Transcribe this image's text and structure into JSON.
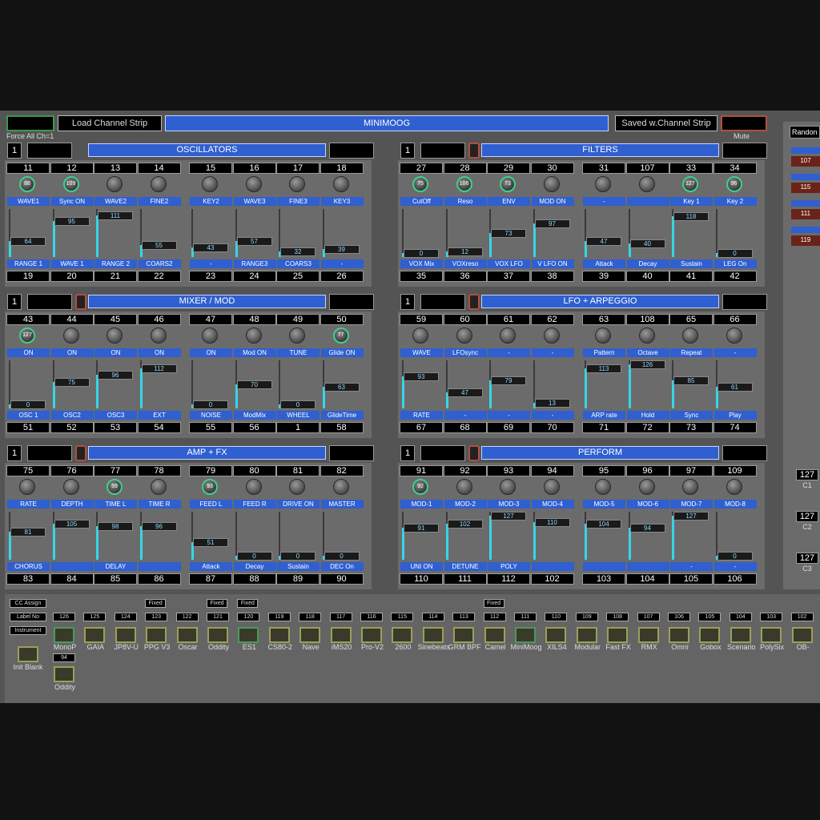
{
  "header": {
    "load_label": "Load Channel Strip",
    "title": "MINIMOOG",
    "save_label": "Saved w.Channel Strip",
    "force_label": "Force All Ch=1",
    "mute_label": "Mute",
    "random_label": "Randon"
  },
  "sections": [
    {
      "id": "oscillators",
      "title": "OSCILLATORS",
      "channel": "1",
      "cc_top": [
        "11",
        "12",
        "13",
        "14",
        "15",
        "16",
        "17",
        "18"
      ],
      "knobs": [
        "88",
        "109",
        "",
        "",
        "",
        "",
        "",
        ""
      ],
      "knob_labels": [
        "WAVE1",
        "Sync ON",
        "WAVE2",
        "FINE2",
        "KEY2",
        "WAVE3",
        "FINE3",
        "KEY3"
      ],
      "faders": [
        "64",
        "95",
        "111",
        "55",
        "43",
        "57",
        "32",
        "39"
      ],
      "fader_levels": [
        0.3,
        0.8,
        0.95,
        0.2,
        0.15,
        0.3,
        0.05,
        0.1
      ],
      "fader_labels": [
        "RANGE 1",
        "WAVE 1",
        "RANGE 2",
        "COARS2",
        "-",
        "RANGE3",
        "COARS3",
        "-"
      ],
      "cc_bottom": [
        "19",
        "20",
        "21",
        "22",
        "23",
        "24",
        "25",
        "26"
      ]
    },
    {
      "id": "filters",
      "title": "FILTERS",
      "channel": "1",
      "cc_top": [
        "27",
        "28",
        "29",
        "30",
        "31",
        "107",
        "33",
        "34"
      ],
      "knobs": [
        "75",
        "106",
        "73",
        "",
        "",
        "",
        "127",
        "96"
      ],
      "knob_labels": [
        "CutOff",
        "Reso",
        "ENV",
        "MOD ON",
        "-",
        "",
        "Key 1",
        "Key 2"
      ],
      "faders": [
        "0",
        "12",
        "73",
        "97",
        "47",
        "40",
        "118",
        "0"
      ],
      "fader_levels": [
        0,
        0.05,
        0.5,
        0.75,
        0.3,
        0.25,
        0.93,
        0
      ],
      "fader_labels": [
        "VOX Mix",
        "VOXreso",
        "VOX LFO",
        "V LFO ON",
        "Attack",
        "Decay",
        "Sustain",
        "LEG On"
      ],
      "cc_bottom": [
        "35",
        "36",
        "37",
        "38",
        "39",
        "40",
        "41",
        "42"
      ]
    },
    {
      "id": "mixer",
      "title": "MIXER / MOD",
      "channel": "1",
      "cc_top": [
        "43",
        "44",
        "45",
        "46",
        "47",
        "48",
        "49",
        "50"
      ],
      "knobs": [
        "127",
        "",
        "",
        "",
        "",
        "",
        "",
        "77"
      ],
      "knob_labels": [
        "ON",
        "ON",
        "ON",
        "ON",
        "ON",
        "Mod ON",
        "TUNE",
        "Glide ON"
      ],
      "faders": [
        "0",
        "75",
        "96",
        "112",
        "0",
        "70",
        "0",
        "63"
      ],
      "fader_labels": [
        "OSC 1",
        "OSC2",
        "OSC3",
        "EXT",
        "NOISE",
        "ModMix",
        "WHEEL",
        "GlideTime"
      ],
      "fader_levels": [
        0,
        0.55,
        0.75,
        0.9,
        0,
        0.5,
        0,
        0.45
      ],
      "cc_bottom": [
        "51",
        "52",
        "53",
        "54",
        "55",
        "56",
        "1",
        "58"
      ]
    },
    {
      "id": "lfo",
      "title": "LFO + ARPEGGIO",
      "channel": "1",
      "cc_top": [
        "59",
        "60",
        "61",
        "62",
        "63",
        "108",
        "65",
        "66"
      ],
      "knobs": [
        "",
        "",
        "",
        "",
        "",
        "",
        "",
        ""
      ],
      "knob_labels": [
        "WAVE",
        "LFOsync",
        "-",
        "-",
        "Pattern",
        "Octave",
        "Repeat",
        "-"
      ],
      "faders": [
        "93",
        "47",
        "79",
        "13",
        "113",
        "126",
        "85",
        "61"
      ],
      "fader_levels": [
        0.7,
        0.3,
        0.6,
        0.05,
        0.9,
        1.0,
        0.6,
        0.45
      ],
      "fader_labels": [
        "RATE",
        "-",
        "-",
        "-",
        "ARP rate",
        "Hold",
        "Sync",
        "Play"
      ],
      "cc_bottom": [
        "67",
        "68",
        "69",
        "70",
        "71",
        "72",
        "73",
        "74"
      ]
    },
    {
      "id": "amp",
      "title": "AMP + FX",
      "channel": "1",
      "cc_top": [
        "75",
        "76",
        "77",
        "78",
        "79",
        "80",
        "81",
        "82"
      ],
      "knobs": [
        "",
        "",
        "59",
        "",
        "93",
        "",
        "",
        ""
      ],
      "knob_labels": [
        "RATE",
        "DEPTH",
        "TIME L",
        "TIME R",
        "FEED L",
        "FEED R",
        "DRIVE ON",
        "MASTER"
      ],
      "faders": [
        "81",
        "105",
        "98",
        "96",
        "51",
        "0",
        "0",
        "0"
      ],
      "fader_levels": [
        0.6,
        0.8,
        0.75,
        0.75,
        0.35,
        0,
        0,
        0
      ],
      "fader_labels": [
        "CHORUS",
        "",
        "DELAY",
        "",
        "Attack",
        "Decay",
        "Sustain",
        "DEC On"
      ],
      "cc_bottom": [
        "83",
        "84",
        "85",
        "86",
        "87",
        "88",
        "89",
        "90"
      ]
    },
    {
      "id": "perform",
      "title": "PERFORM",
      "channel": "1",
      "cc_top": [
        "91",
        "92",
        "93",
        "94",
        "95",
        "96",
        "97",
        "109"
      ],
      "knobs": [
        "92",
        "",
        "",
        "",
        "",
        "",
        "",
        ""
      ],
      "knob_labels": [
        "MOD-1",
        "MOD-2",
        "MOD-3",
        "MOD-4",
        "MOD-5",
        "MOD-6",
        "MOD-7",
        "MOD-8"
      ],
      "faders": [
        "91",
        "102",
        "127",
        "110",
        "104",
        "94",
        "127",
        "0"
      ],
      "fader_levels": [
        0.7,
        0.8,
        1.0,
        0.85,
        0.8,
        0.7,
        1.0,
        0
      ],
      "fader_labels": [
        "UNI ON",
        "DETUNE",
        "POLY",
        "",
        "",
        "",
        "-",
        "-"
      ],
      "cc_bottom": [
        "110",
        "111",
        "112",
        "102",
        "103",
        "104",
        "105",
        "106"
      ]
    }
  ],
  "right_panel": {
    "red_values": [
      "107",
      "115",
      "111",
      "119"
    ],
    "channels": [
      {
        "value": "127",
        "label": "C1"
      },
      {
        "value": "127",
        "label": "C2"
      },
      {
        "value": "127",
        "label": "C3"
      }
    ]
  },
  "bottom": {
    "cc_assign": "CC Assign",
    "label_no": "Label No",
    "instrument": "Instrument",
    "init_blank": "Init Blank",
    "fixed_label": "Fixed",
    "presets": [
      {
        "num": "126",
        "name": "MonoP",
        "fixed": false,
        "green": true
      },
      {
        "num": "125",
        "name": "GAIA",
        "fixed": false,
        "green": false
      },
      {
        "num": "124",
        "name": "JP8V-U",
        "fixed": false,
        "green": false
      },
      {
        "num": "123",
        "name": "PPG V3",
        "fixed": true,
        "green": false
      },
      {
        "num": "122",
        "name": "Oscar",
        "fixed": false,
        "green": false
      },
      {
        "num": "121",
        "name": "Oddity",
        "fixed": true,
        "green": false
      },
      {
        "num": "120",
        "name": "ES1",
        "fixed": true,
        "green": true
      },
      {
        "num": "119",
        "name": "CS80-2",
        "fixed": false,
        "green": false
      },
      {
        "num": "118",
        "name": "Nave",
        "fixed": false,
        "green": false
      },
      {
        "num": "117",
        "name": "iMS20",
        "fixed": false,
        "green": false
      },
      {
        "num": "116",
        "name": "Pro-V2",
        "fixed": false,
        "green": false
      },
      {
        "num": "115",
        "name": "2600",
        "fixed": false,
        "green": false
      },
      {
        "num": "114",
        "name": "Sinebeats",
        "fixed": false,
        "green": false
      },
      {
        "num": "113",
        "name": "GRM BPF",
        "fixed": false,
        "green": false
      },
      {
        "num": "112",
        "name": "Camel",
        "fixed": true,
        "green": false
      },
      {
        "num": "111",
        "name": "MiniMoog",
        "fixed": false,
        "green": true
      },
      {
        "num": "110",
        "name": "XILS4",
        "fixed": false,
        "green": false
      },
      {
        "num": "109",
        "name": "Modular",
        "fixed": false,
        "green": false
      },
      {
        "num": "108",
        "name": "Fast FX",
        "fixed": false,
        "green": false
      },
      {
        "num": "107",
        "name": "RMX",
        "fixed": false,
        "green": false
      },
      {
        "num": "106",
        "name": "Omni",
        "fixed": false,
        "green": false
      },
      {
        "num": "105",
        "name": "Gobox",
        "fixed": false,
        "green": false
      },
      {
        "num": "104",
        "name": "Scenario",
        "fixed": false,
        "green": false
      },
      {
        "num": "103",
        "name": "PolySix",
        "fixed": false,
        "green": false
      },
      {
        "num": "102",
        "name": "OB-",
        "fixed": false,
        "green": false
      }
    ],
    "extra": {
      "num": "94",
      "name": "Oddity"
    }
  }
}
